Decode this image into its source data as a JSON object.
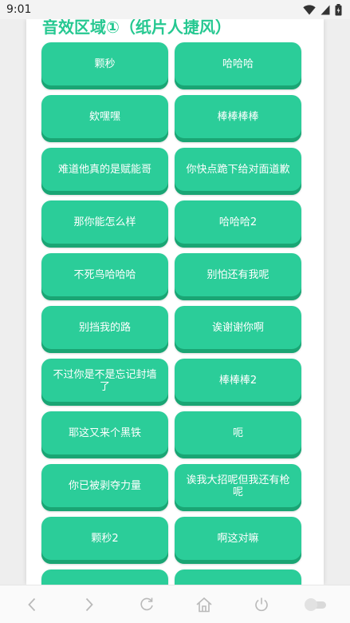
{
  "status_bar": {
    "time": "9:01"
  },
  "section": {
    "title": "音效区域①（纸片人捷风）"
  },
  "buttons": [
    "颗秒",
    "哈哈哈",
    "欸嘿嘿",
    "棒棒棒棒",
    "难道他真的是赋能哥",
    "你快点跪下给对面道歉",
    "那你能怎么样",
    "哈哈哈2",
    "不死鸟哈哈哈",
    "别怕还有我呢",
    "别挡我的路",
    "诶谢谢你啊",
    "不过你是不是忘记封墙了",
    "棒棒棒2",
    "耶这又来个黑铁",
    "呃",
    "你已被剥夺力量",
    "诶我大招呢但我还有枪呢",
    "颗秒2",
    "啊这对嘛",
    "",
    ""
  ],
  "nav_icons": [
    "back-icon",
    "forward-icon",
    "refresh-icon",
    "home-icon",
    "power-icon",
    "toggle-icon"
  ],
  "colors": {
    "accent": "#2bcd99",
    "accent_dark": "#1aa574",
    "title": "#26c891"
  }
}
